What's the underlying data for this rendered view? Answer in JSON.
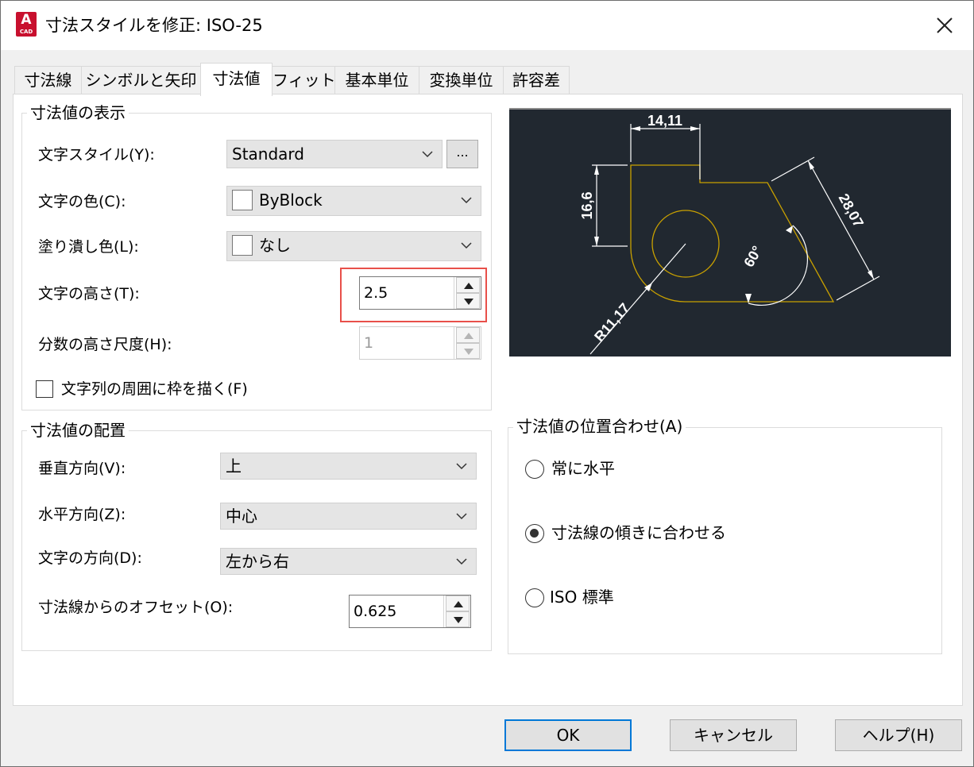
{
  "window": {
    "title": "寸法スタイルを修正: ISO-25",
    "app_icon_letter": "A",
    "app_icon_sub": "CAD"
  },
  "tabs": [
    {
      "label": "寸法線"
    },
    {
      "label": "シンボルと矢印"
    },
    {
      "label": "寸法値",
      "active": true
    },
    {
      "label": "フィット"
    },
    {
      "label": "基本単位"
    },
    {
      "label": "変換単位"
    },
    {
      "label": "許容差"
    }
  ],
  "appearance": {
    "group_title": "寸法値の表示",
    "text_style_label": "文字スタイル(Y):",
    "text_style_value": "Standard",
    "text_style_button": "...",
    "text_color_label": "文字の色(C):",
    "text_color_value": "ByBlock",
    "fill_color_label": "塗り潰し色(L):",
    "fill_color_value": "なし",
    "text_height_label": "文字の高さ(T):",
    "text_height_value": "2.5",
    "fraction_scale_label": "分数の高さ尺度(H):",
    "fraction_scale_value": "1",
    "draw_frame_label": "文字列の周囲に枠を描く(F)",
    "draw_frame_checked": false
  },
  "placement": {
    "group_title": "寸法値の配置",
    "vertical_label": "垂直方向(V):",
    "vertical_value": "上",
    "horizontal_label": "水平方向(Z):",
    "horizontal_value": "中心",
    "view_direction_label": "文字の方向(D):",
    "view_direction_value": "左から右",
    "offset_label": "寸法線からのオフセット(O):",
    "offset_value": "0.625"
  },
  "alignment": {
    "group_title": "寸法値の位置合わせ(A)",
    "options": [
      {
        "label": "常に水平",
        "selected": false
      },
      {
        "label": "寸法線の傾きに合わせる",
        "selected": true
      },
      {
        "label": "ISO 標準",
        "selected": false
      }
    ]
  },
  "preview": {
    "dim_top": "14,11",
    "dim_left": "16,6",
    "dim_slant": "28,07",
    "dim_angle": "60°",
    "dim_radius": "R11,17",
    "bg_color": "#212830",
    "geometry_color": "#c8a000",
    "dim_color": "#ffffff"
  },
  "buttons": {
    "ok": "OK",
    "cancel": "キャンセル",
    "help": "ヘルプ(H)"
  },
  "colors": {
    "highlight": "#e8504a",
    "default_button_border": "#0078d7"
  }
}
